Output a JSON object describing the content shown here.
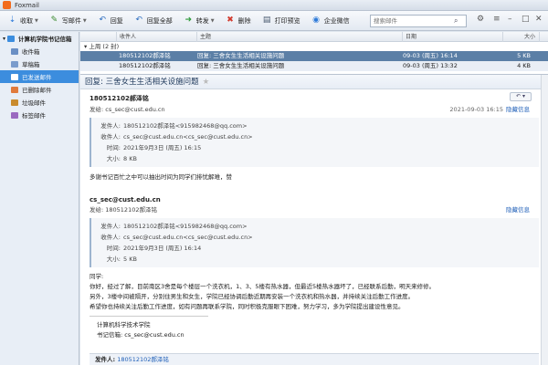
{
  "app": {
    "title": "Foxmail"
  },
  "toolbar": {
    "receive": "收取",
    "compose": "写邮件",
    "reply": "回复",
    "reply_all": "回复全部",
    "forward": "转发",
    "delete": "删除",
    "print_preview": "打印预览",
    "enterprise_wechat": "企业微信",
    "search_placeholder": "搜索邮件"
  },
  "sidebar": {
    "account": "计算机学院书记信箱",
    "folders": [
      {
        "label": "收件箱",
        "color": "#6a8fc4"
      },
      {
        "label": "草稿箱",
        "color": "#7a9ccc"
      },
      {
        "label": "已发送邮件",
        "color": "#5d86bf",
        "active": true
      },
      {
        "label": "已删除邮件",
        "color": "#e07a3c"
      },
      {
        "label": "垃圾邮件",
        "color": "#c98b2e"
      },
      {
        "label": "标签邮件",
        "color": "#9a6ac0"
      }
    ]
  },
  "list": {
    "columns": {
      "from": "收件人",
      "subject": "主题",
      "date": "日期",
      "size": "大小"
    },
    "group": "上周 (2 封)",
    "rows": [
      {
        "from": "180512102郝泽铭",
        "subject": "回复: 三舍女生生活相关设施问题",
        "date": "09-03 (周五) 16:14",
        "size": "5 KB"
      },
      {
        "from": "180512102郝泽铭",
        "subject": "回复: 三舍女生生活相关设施问题",
        "date": "09-03 (周五) 13:32",
        "size": "4 KB"
      }
    ]
  },
  "reader": {
    "title": "回复: 三舍女生生活相关设施问题",
    "sender": "180512102郝泽铭",
    "from_line": "发给: cs_sec@cust.edu.cn",
    "timestamp": "2021-09-03 16:15",
    "hide_link": "隐藏信息",
    "header1": {
      "from_label": "发件人:",
      "from": "180512102郝泽铭<915982468@qq.com>",
      "to_label": "收件人:",
      "to": "cs_sec@cust.edu.cn<cs_sec@cust.edu.cn>",
      "time_label": "时间:",
      "time": "2021年9月3日 (周五) 16:15",
      "size_label": "大小:",
      "size": "8 KB"
    },
    "body1": "多谢书记百忙之中可以抽出时间为同学们排忧解难，赞",
    "sender2": "cs_sec@cust.edu.cn",
    "from_line2": "发给: 180512102郝泽铭",
    "header2": {
      "from_label": "发件人:",
      "from": "180512102郝泽铭<915982468@qq.com>",
      "to_label": "收件人:",
      "to": "cs_sec@cust.edu.cn<cs_sec@cust.edu.cn>",
      "time_label": "时间:",
      "time": "2021年9月3日 (周五) 16:14",
      "size_label": "大小:",
      "size": "5 KB"
    },
    "body2": [
      "同学:",
      "    你好，经过了解，目前南区3舍是每个楼层一个洗衣机，1、3、5楼有热水器，但最近5楼热水器坏了，已经联系后勤，明天来修修。",
      "另外，3楼中间被隔开，分别住男生和女生，学院已经协调后勤近期再安装一个洗衣机和热水器，并持续关注后勤工作进度。",
      "    希望你也持续关注后勤工作进度，如有问题再联系学院，同时积极克服眼下困难，努力学习，多为学院提出建设性意见。"
    ],
    "signature": [
      "计算机科学技术学院",
      "书记信箱: cs_sec@cust.edu.cn"
    ],
    "bottom": {
      "label": "发件人:",
      "value": "180512102郝泽铭"
    }
  }
}
